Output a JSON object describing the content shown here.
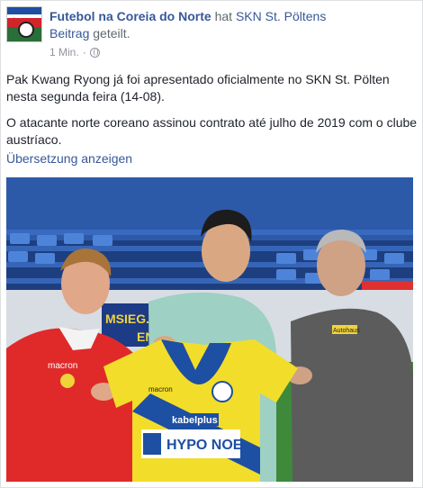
{
  "post": {
    "page_name": "Futebol na Coreia do Norte",
    "action_text": "hat",
    "shared_page": "SKN St. Pöltens",
    "shared_item": "Beitrag",
    "shared_suffix": "geteilt.",
    "time": "1 Min.",
    "separator": "·",
    "paragraphs": [
      "Pak Kwang Ryong já foi apresentado oficialmente no SKN St. Pölten nesta segunda feira (14-08).",
      "O atacante norte coreano assinou contrato até julho de 2019 com o clube austríaco."
    ],
    "translate_label": "Übersetzung anzeigen"
  },
  "photo": {
    "jersey_sponsor": "HYPO NOE",
    "jersey_sponsor2": "kabelplus",
    "jersey_brand": "macron",
    "left_shirt_brand": "macron",
    "banner_text": "MSIEG.",
    "banner_text2": "EN",
    "staff_badge": "Autohaus"
  }
}
